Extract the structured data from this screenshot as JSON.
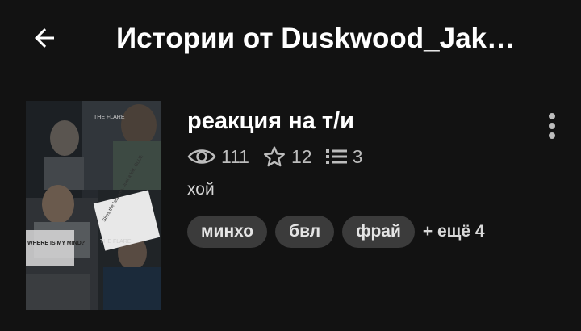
{
  "header": {
    "back_icon": "arrow-left-icon",
    "title": "Истории от Duskwood_Jak…"
  },
  "story": {
    "title": "реакция на т/и",
    "stats": {
      "views": "111",
      "stars": "12",
      "parts": "3"
    },
    "description": "хой",
    "tags": [
      "минхо",
      "бвл",
      "фрай"
    ],
    "more_tags": "+ ещё 4",
    "cover_text": {
      "flare_top": "THE FLARE",
      "flare_mid": "THE FLARE",
      "note": "Shes the last one. Just a kid, GLUE",
      "where": "WHERE IS MY MIND?"
    }
  },
  "colors": {
    "background": "#121212",
    "tag_bg": "#3b3b3b",
    "stat_text": "#bdbdbd"
  }
}
